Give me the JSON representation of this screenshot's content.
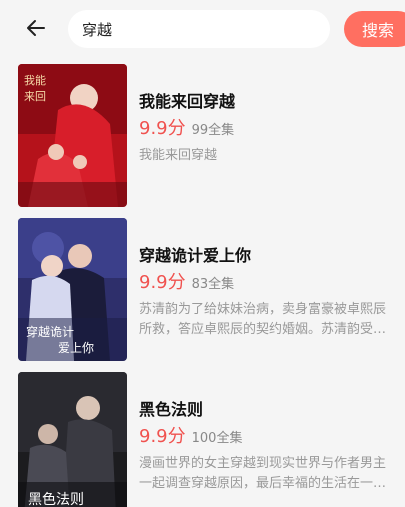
{
  "search": {
    "value": "穿越",
    "button_label": "搜索"
  },
  "results": [
    {
      "title": "我能来回穿越",
      "score": "9.9分",
      "episodes": "99全集",
      "desc_lines": [
        "我能来回穿越"
      ],
      "cover_text": "我能来回"
    },
    {
      "title": "穿越诡计爱上你",
      "score": "9.9分",
      "episodes": "83全集",
      "desc_lines": [
        "苏清韵为了给妹妹治病，卖身富豪被卓熙辰",
        "所救，答应卓熙辰的契约婚姻。苏清韵受…"
      ],
      "cover_text": "穿越诡计 爱上你"
    },
    {
      "title": "黑色法则",
      "score": "9.9分",
      "episodes": "100全集",
      "desc_lines": [
        "漫画世界的女主穿越到现实世界与作者男主",
        "一起调查穿越原因，最后幸福的生活在一…"
      ],
      "cover_text": "黑色法则"
    }
  ]
}
